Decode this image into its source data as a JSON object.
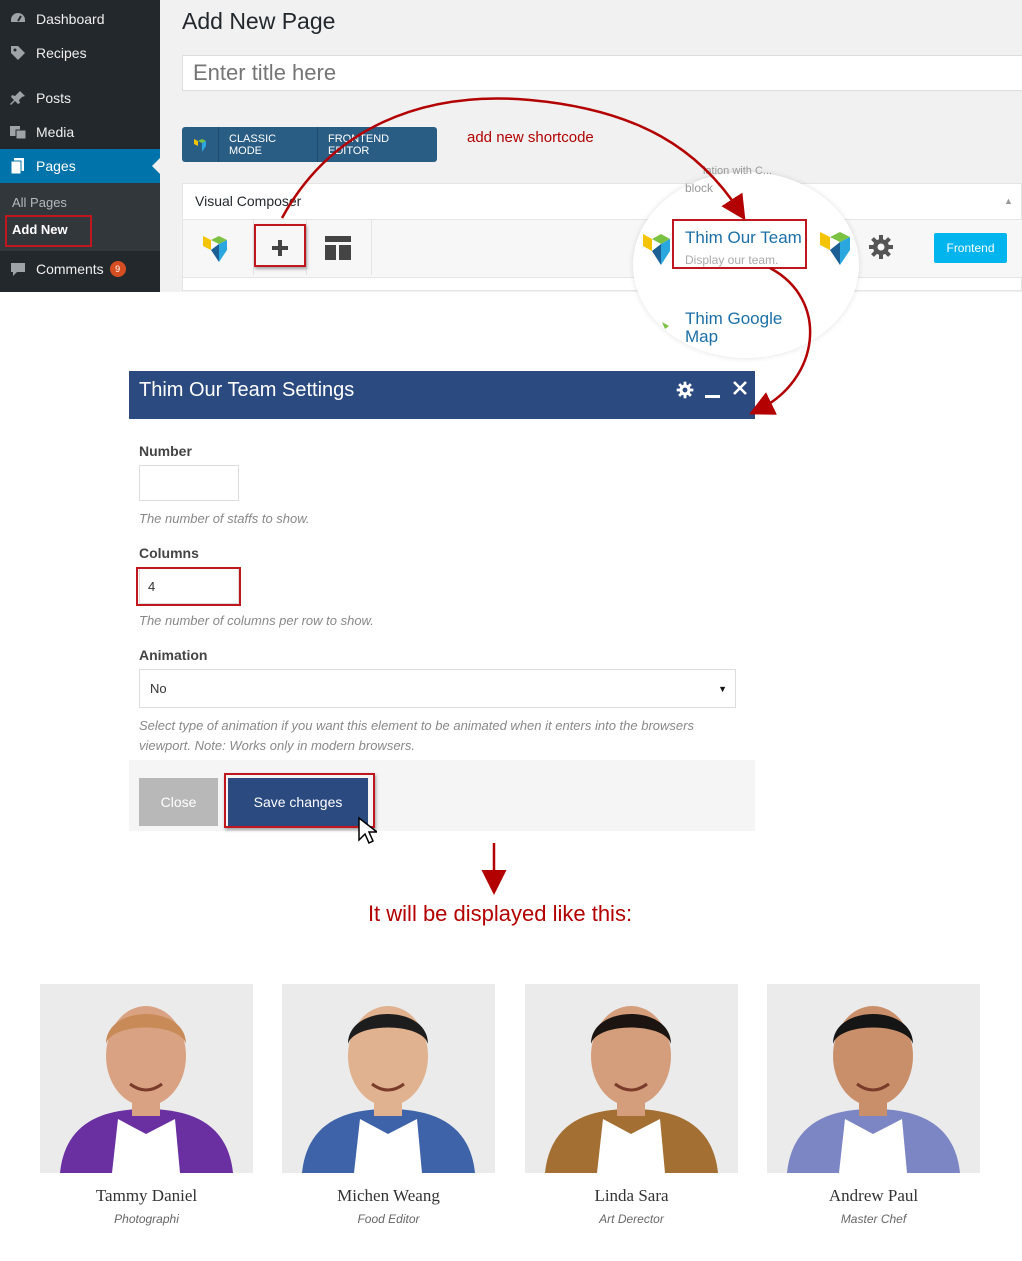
{
  "sidebar": {
    "items": [
      {
        "label": "Dashboard",
        "icon": "dashboard-icon"
      },
      {
        "label": "Recipes",
        "icon": "tag-icon"
      },
      {
        "label": "Posts",
        "icon": "pin-icon"
      },
      {
        "label": "Media",
        "icon": "media-icon"
      },
      {
        "label": "Pages",
        "icon": "pages-icon"
      },
      {
        "label": "Comments",
        "icon": "comment-icon"
      }
    ],
    "submenu": [
      "All Pages",
      "Add New"
    ],
    "comments_count": "9"
  },
  "page": {
    "heading": "Add New Page",
    "title_placeholder": "Enter title here"
  },
  "mode_bar": {
    "classic": "CLASSIC MODE",
    "frontend_editor": "FRONTEND EDITOR"
  },
  "annotations": {
    "shortcode": "add new shortcode",
    "display_note": "It will be displayed like this:"
  },
  "composer": {
    "title": "Visual Composer",
    "frontend_button": "Frontend",
    "lens_top": "lation with C...",
    "lens_block": "block",
    "element_title": "Thim Our Team",
    "element_sub": "Display our team.",
    "element2_title": "Thim Google Map"
  },
  "modal": {
    "title": "Thim Our Team Settings",
    "number_label": "Number",
    "number_value": "",
    "number_help": "The number of staffs to show.",
    "columns_label": "Columns",
    "columns_value": "4",
    "columns_help": "The number of columns per row to show.",
    "animation_label": "Animation",
    "animation_value": "No",
    "animation_help_1": "Select type of animation if you want this element to be animated when it enters into the browsers",
    "animation_help_2": "viewport. Note: Works only in modern browsers.",
    "close_label": "Close",
    "save_label": "Save changes"
  },
  "team": [
    {
      "name": "Tammy Daniel",
      "role": "Photographi",
      "shirt": "#6a2fa0",
      "skin": "#d9a383",
      "hair": "#c88a56"
    },
    {
      "name": "Michen Weang",
      "role": "Food Editor",
      "shirt": "#3e63a8",
      "skin": "#e1b28f",
      "hair": "#1d1d1d"
    },
    {
      "name": "Linda Sara",
      "role": "Art Derector",
      "shirt": "#a46f33",
      "skin": "#d49d7c",
      "hair": "#1b1410"
    },
    {
      "name": "Andrew Paul",
      "role": "Master Chef",
      "shirt": "#7d86c4",
      "skin": "#c98f6a",
      "hair": "#151515"
    }
  ],
  "colors": {
    "wp_blue": "#0073aa",
    "modal_header": "#2a4a80",
    "annotation_red": "#b30000",
    "frontend": "#00b4ed"
  }
}
